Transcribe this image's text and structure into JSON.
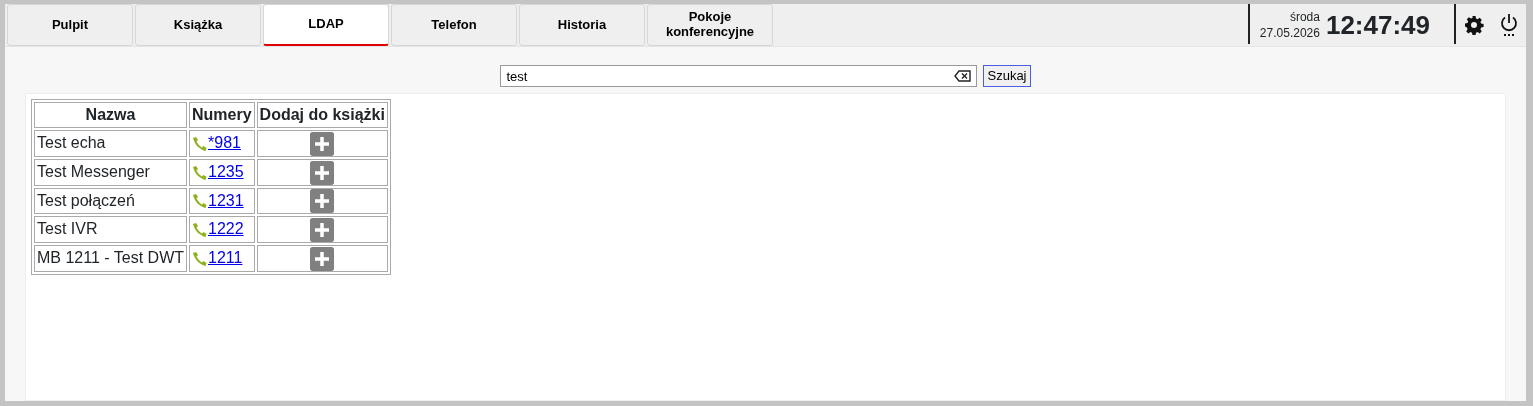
{
  "tabs": [
    {
      "label": "Pulpit",
      "selected": false
    },
    {
      "label": "Książka",
      "selected": false
    },
    {
      "label": "LDAP",
      "selected": true
    },
    {
      "label": "Telefon",
      "selected": false
    },
    {
      "label": "Historia",
      "selected": false
    },
    {
      "label": "Pokoje konferencyjne",
      "selected": false
    }
  ],
  "clock": {
    "weekday": "środa",
    "date": "27.05.2026",
    "time": "12:47:49"
  },
  "search": {
    "value": "test",
    "button": "Szukaj"
  },
  "table": {
    "columns": [
      "Nazwa",
      "Numery",
      "Dodaj do książki"
    ],
    "rows": [
      {
        "name": "Test echa",
        "number": "*981"
      },
      {
        "name": "Test Messenger",
        "number": "1235"
      },
      {
        "name": "Test połączeń",
        "number": "1231"
      },
      {
        "name": "Test IVR",
        "number": "1222"
      },
      {
        "name": "MB 1211 - Test DWT",
        "number": "1211"
      }
    ]
  }
}
